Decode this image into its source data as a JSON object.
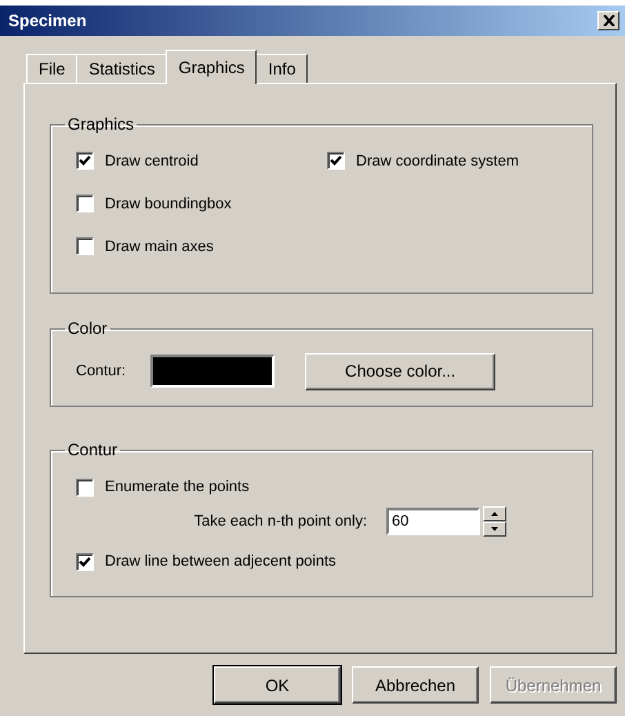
{
  "window": {
    "title": "Specimen"
  },
  "tabs": [
    {
      "label": "File",
      "selected": false
    },
    {
      "label": "Statistics",
      "selected": false
    },
    {
      "label": "Graphics",
      "selected": true
    },
    {
      "label": "Info",
      "selected": false
    }
  ],
  "graphics": {
    "title": "Graphics",
    "rows": [
      [
        {
          "label": "Draw centroid",
          "checked": true
        },
        {
          "label": "Draw coordinate system",
          "checked": true
        }
      ],
      [
        {
          "label": "Draw boundingbox",
          "checked": false
        }
      ],
      [
        {
          "label": "Draw main axes",
          "checked": false
        }
      ]
    ]
  },
  "color": {
    "title": "Color",
    "label": "Contur:",
    "color": "#000000",
    "button": "Choose color..."
  },
  "contur": {
    "title": "Contur",
    "items": [
      {
        "kind": "checkbox",
        "label": "Enumerate the points",
        "checked": false
      },
      {
        "kind": "spin",
        "label": "Take each n-th point only:",
        "value": "60"
      },
      {
        "kind": "checkbox",
        "label": "Draw line between adjecent points",
        "checked": true
      }
    ]
  },
  "buttons": [
    {
      "label": "OK",
      "disabled": false
    },
    {
      "label": "Abbrechen",
      "disabled": false
    },
    {
      "label": "Übernehmen",
      "disabled": true
    }
  ]
}
